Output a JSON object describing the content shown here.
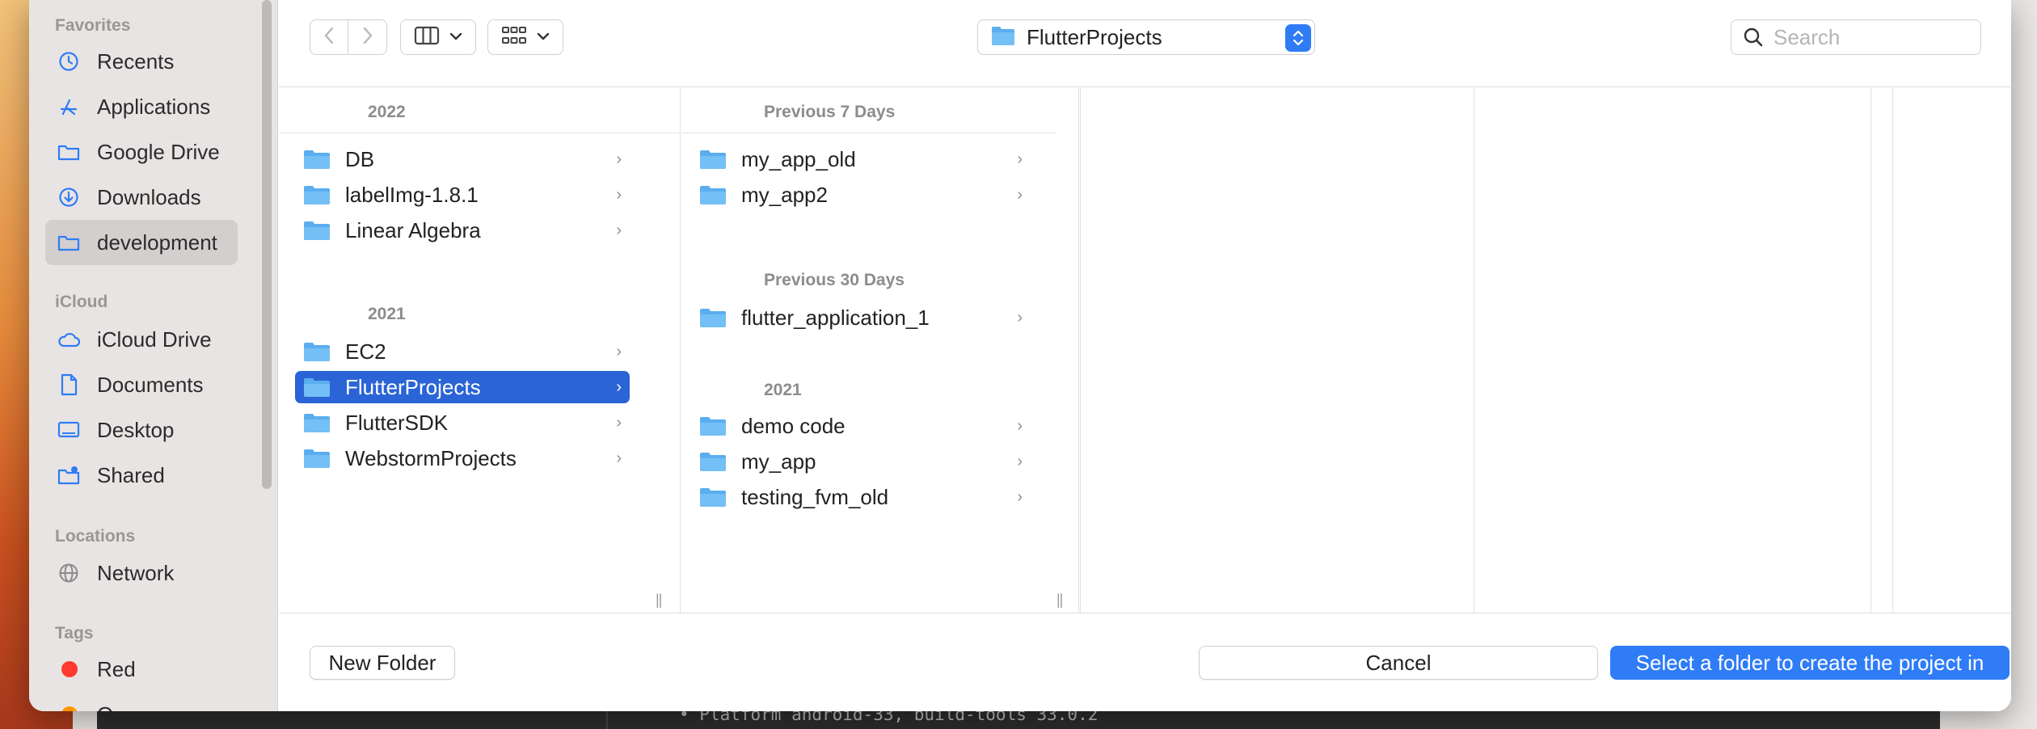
{
  "background": {
    "terminal_line": "• Platform android-33, build-tools 33.0.2"
  },
  "sidebar": {
    "sections": [
      {
        "heading": "Favorites",
        "items": [
          {
            "label": "Recents",
            "icon": "clock-icon"
          },
          {
            "label": "Applications",
            "icon": "applications-icon"
          },
          {
            "label": "Google Drive",
            "icon": "folder-icon"
          },
          {
            "label": "Downloads",
            "icon": "download-icon"
          },
          {
            "label": "development",
            "icon": "folder-icon",
            "active": true
          }
        ]
      },
      {
        "heading": "iCloud",
        "items": [
          {
            "label": "iCloud Drive",
            "icon": "cloud-icon"
          },
          {
            "label": "Documents",
            "icon": "document-icon"
          },
          {
            "label": "Desktop",
            "icon": "desktop-icon"
          },
          {
            "label": "Shared",
            "icon": "shared-folder-icon"
          }
        ]
      },
      {
        "heading": "Locations",
        "items": [
          {
            "label": "Network",
            "icon": "globe-icon"
          }
        ]
      },
      {
        "heading": "Tags",
        "items": [
          {
            "label": "Red",
            "color": "#ff3b30"
          },
          {
            "label": "O...",
            "color": "#ff9500"
          }
        ]
      }
    ]
  },
  "toolbar": {
    "path_label": "FlutterProjects",
    "search_placeholder": "Search"
  },
  "columns": [
    {
      "groups": [
        {
          "heading": "2022",
          "rows": [
            "DB",
            "labelImg-1.8.1",
            "Linear Algebra"
          ]
        },
        {
          "heading": "2021",
          "rows": [
            "EC2",
            "FlutterProjects",
            "FlutterSDK",
            "WebstormProjects"
          ],
          "selected": "FlutterProjects"
        }
      ]
    },
    {
      "groups": [
        {
          "heading": "Previous 7 Days",
          "rows": [
            "my_app_old",
            "my_app2"
          ]
        },
        {
          "heading": "Previous 30 Days",
          "rows": [
            "flutter_application_1"
          ]
        },
        {
          "heading": "2021",
          "rows": [
            "demo code",
            "my_app",
            "testing_fvm_old"
          ]
        }
      ]
    }
  ],
  "footer": {
    "new_folder": "New Folder",
    "cancel": "Cancel",
    "primary": "Select a folder to create the project in"
  },
  "colors": {
    "accent": "#2f7cf6",
    "selection": "#2a64d6",
    "folder": "#5aaef0"
  }
}
